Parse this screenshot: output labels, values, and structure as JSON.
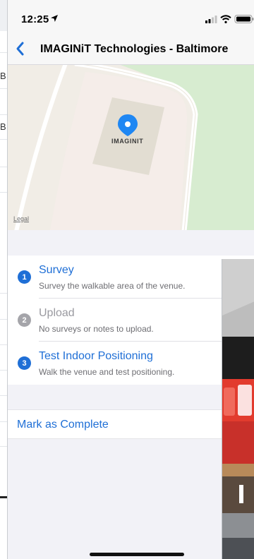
{
  "status_bar": {
    "time": "12:25",
    "icons": [
      "location-arrow-icon",
      "signal-icon",
      "wifi-icon",
      "battery-icon"
    ]
  },
  "nav": {
    "title": "IMAGINiT Technologies - Baltimore",
    "back_icon": "chevron-left-icon"
  },
  "map": {
    "pin_label": "IMAGINIT",
    "legal_label": "Legal"
  },
  "steps": [
    {
      "number": "1",
      "title": "Survey",
      "subtitle": "Survey the walkable area of the venue.",
      "enabled": true
    },
    {
      "number": "2",
      "title": "Upload",
      "subtitle": "No surveys or notes to upload.",
      "enabled": false
    },
    {
      "number": "3",
      "title": "Test Indoor Positioning",
      "subtitle": "Walk the venue and test positioning.",
      "enabled": true
    }
  ],
  "actions": {
    "mark_complete": "Mark as Complete"
  },
  "background_window": {
    "letters": [
      "B",
      "B"
    ]
  },
  "colors": {
    "accent": "#1f6fd6",
    "disabled": "#a5a5aa",
    "map_land": "#f1ede6",
    "map_park": "#d7ecd0",
    "map_building": "#e2ddd2"
  }
}
